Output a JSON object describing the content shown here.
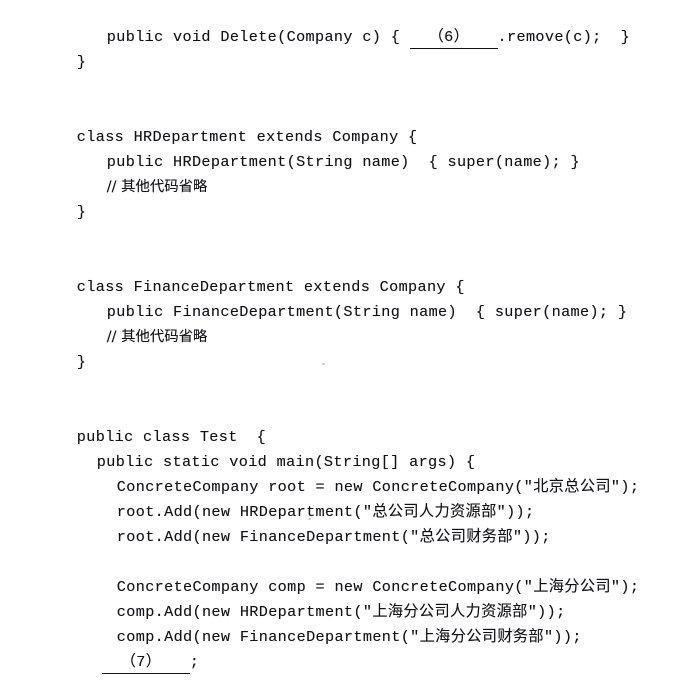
{
  "document": {
    "type": "scanned-code-listing",
    "language": "Java",
    "background_color": "#ffffff",
    "text_color": "#15161a",
    "line_height_px": 25,
    "blank_markers": [
      "（6）",
      "（7）"
    ]
  },
  "code": {
    "lines": [
      {
        "id": "l1",
        "indent": 3,
        "text": "public void Delete(Company c) { ",
        "blank": "（6）",
        "after_blank": ".remove(c);  }"
      },
      {
        "id": "l2",
        "indent": 0,
        "text": "}"
      },
      {
        "id": "l3",
        "indent": 0,
        "text": ""
      },
      {
        "id": "l4",
        "indent": 0,
        "text": ""
      },
      {
        "id": "l5",
        "indent": 0,
        "text": "class HRDepartment extends Company {"
      },
      {
        "id": "l6",
        "indent": 3,
        "text": "public HRDepartment(String name)  { super(name); }"
      },
      {
        "id": "l7",
        "indent": 3,
        "text": "// 其他代码省略"
      },
      {
        "id": "l8",
        "indent": 0,
        "text": "}"
      },
      {
        "id": "l9",
        "indent": 0,
        "text": ""
      },
      {
        "id": "l10",
        "indent": 0,
        "text": ""
      },
      {
        "id": "l11",
        "indent": 0,
        "text": "class FinanceDepartment extends Company {"
      },
      {
        "id": "l12",
        "indent": 3,
        "text": "public FinanceDepartment(String name)  { super(name); }"
      },
      {
        "id": "l13",
        "indent": 3,
        "text": "// 其他代码省略"
      },
      {
        "id": "l14",
        "indent": 0,
        "text": "}"
      },
      {
        "id": "l15",
        "indent": 0,
        "text": ""
      },
      {
        "id": "l16",
        "indent": 0,
        "text": ""
      },
      {
        "id": "l17",
        "indent": 0,
        "text": "public class Test  {"
      },
      {
        "id": "l18",
        "indent": 2,
        "text": "public static void main(String[] args) {"
      },
      {
        "id": "l19",
        "indent": 4,
        "text": "ConcreteCompany root = new ConcreteCompany(\"北京总公司\");"
      },
      {
        "id": "l20",
        "indent": 4,
        "text": "root.Add(new HRDepartment(\"总公司人力资源部\"));"
      },
      {
        "id": "l21",
        "indent": 4,
        "text": "root.Add(new FinanceDepartment(\"总公司财务部\"));"
      },
      {
        "id": "l22",
        "indent": 0,
        "text": ""
      },
      {
        "id": "l23",
        "indent": 4,
        "text": "ConcreteCompany comp = new ConcreteCompany(\"上海分公司\");"
      },
      {
        "id": "l24",
        "indent": 4,
        "text": "comp.Add(new HRDepartment(\"上海分公司人力资源部\"));"
      },
      {
        "id": "l25",
        "indent": 4,
        "text": "comp.Add(new FinanceDepartment(\"上海分公司财务部\"));"
      },
      {
        "id": "l26",
        "indent": 4,
        "text": "",
        "blank": "（7）",
        "after_blank": ";"
      }
    ]
  }
}
